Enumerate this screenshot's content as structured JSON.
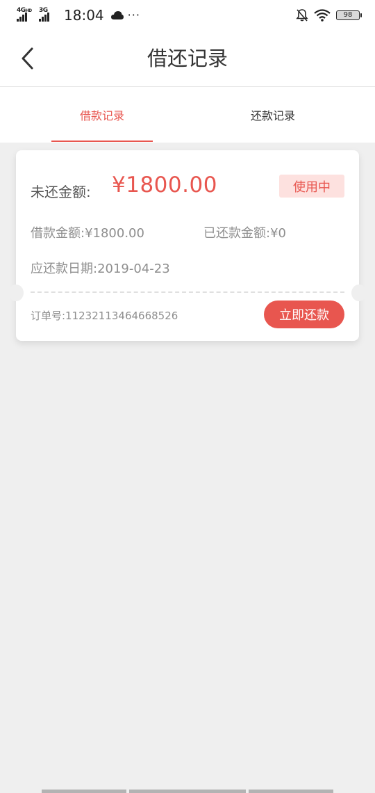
{
  "status_bar": {
    "network1": "4G",
    "network1_sup": "HD",
    "network2": "3G",
    "time": "18:04",
    "more": "···",
    "battery": "98"
  },
  "nav": {
    "title": "借还记录"
  },
  "tabs": [
    {
      "label": "借款记录",
      "active": true
    },
    {
      "label": "还款记录",
      "active": false
    }
  ],
  "card": {
    "unpaid_label": "未还金额:",
    "unpaid_value": "¥1800.00",
    "status": "使用中",
    "loan_amount": "借款金额:¥1800.00",
    "repaid_amount": "已还款金额:¥0",
    "due_date": "应还款日期:2019-04-23",
    "order_no": "订单号:11232113464668526",
    "repay_button": "立即还款"
  },
  "colors": {
    "accent": "#e8564f",
    "badge_bg": "#fde1df",
    "page_bg": "#efefef"
  }
}
